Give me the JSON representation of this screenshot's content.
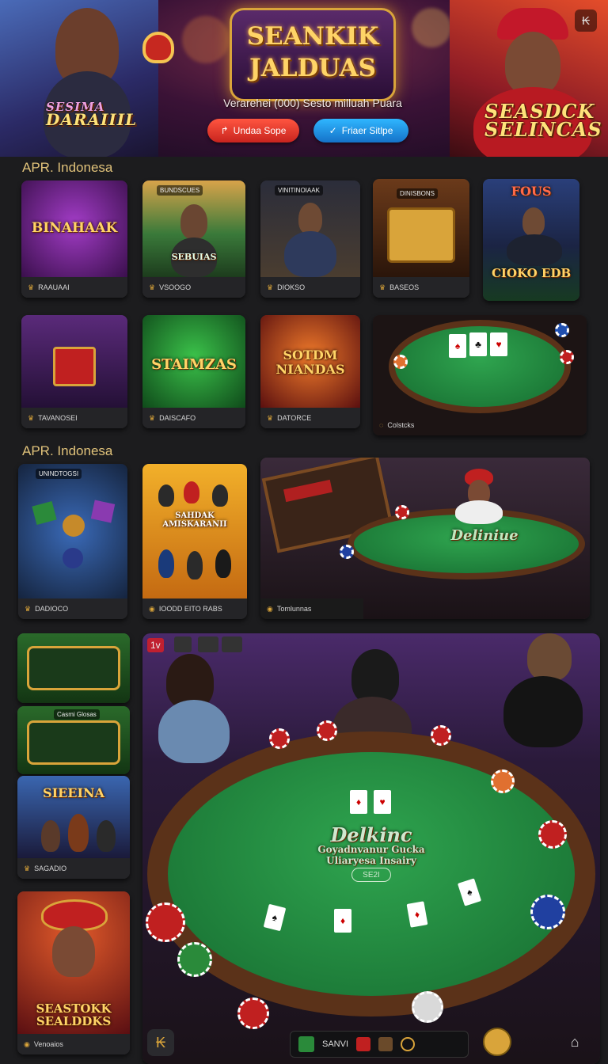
{
  "hero": {
    "title_line1": "SEANKIK",
    "title_line2": "JALDUAS",
    "subtitle": "Verarehei (000) Sesto milluah Puara",
    "left_sign_line1": "SESIMA",
    "left_sign_line2": "DARAIIIL",
    "right_sign_line1": "SEASDCK",
    "right_sign_line2": "SELINCAS",
    "button_primary": "Undaa Sope",
    "button_secondary": "Friaer Sitlpe",
    "corner_icon": "₭"
  },
  "sections": [
    {
      "title": "APR. Indonesa"
    },
    {
      "title": "APR. Indonesa"
    }
  ],
  "row1": [
    {
      "logo": "BINAHAAK",
      "caption": "RAAUAAI"
    },
    {
      "badge": "BUNDSCUES",
      "logo": "SEBUIAS",
      "caption": "VSOOGO"
    },
    {
      "badge": "VINITINOIAAK",
      "caption": "DIOKSO"
    },
    {
      "badge": "DINISBONS",
      "caption": "BASEOS"
    },
    {
      "badge": "FOUS",
      "logo": "CIOKO EDB",
      "caption": ""
    }
  ],
  "row2": [
    {
      "caption": "TAVANOSEI"
    },
    {
      "logo": "STAIMZAS",
      "caption": "DAISCAFO"
    },
    {
      "logo": "SOTDM NIANDAS",
      "caption": "DATORCE"
    },
    {
      "caption": "Colstcks"
    }
  ],
  "row3": [
    {
      "badge": "UNINDTOGSI",
      "caption": "DADIOCO"
    },
    {
      "logo": "SAHDAK AMISKARANII",
      "caption": "IOODD EITO RABS"
    },
    {
      "table_text": "Deliniue",
      "caption": "Tomlunnas"
    }
  ],
  "left_column": [
    {
      "badge": ""
    },
    {
      "badge": "Casmi Glosas"
    },
    {
      "logo": "SIEEINA",
      "caption": "SAGADIO"
    },
    {
      "logo": "SEASTOKK SEALDDKS",
      "caption": "Venoaios"
    }
  ],
  "main_table": {
    "top_badge": "1v",
    "table_title": "Delkinc",
    "table_sub1": "Goyadnvanur Gucka",
    "table_sub2": "Uliaryesa Insairy",
    "table_badge": "SE2I"
  },
  "bottom_bar": {
    "label": "SANVI",
    "left_icon": "₭",
    "right_icon": "⌂"
  }
}
